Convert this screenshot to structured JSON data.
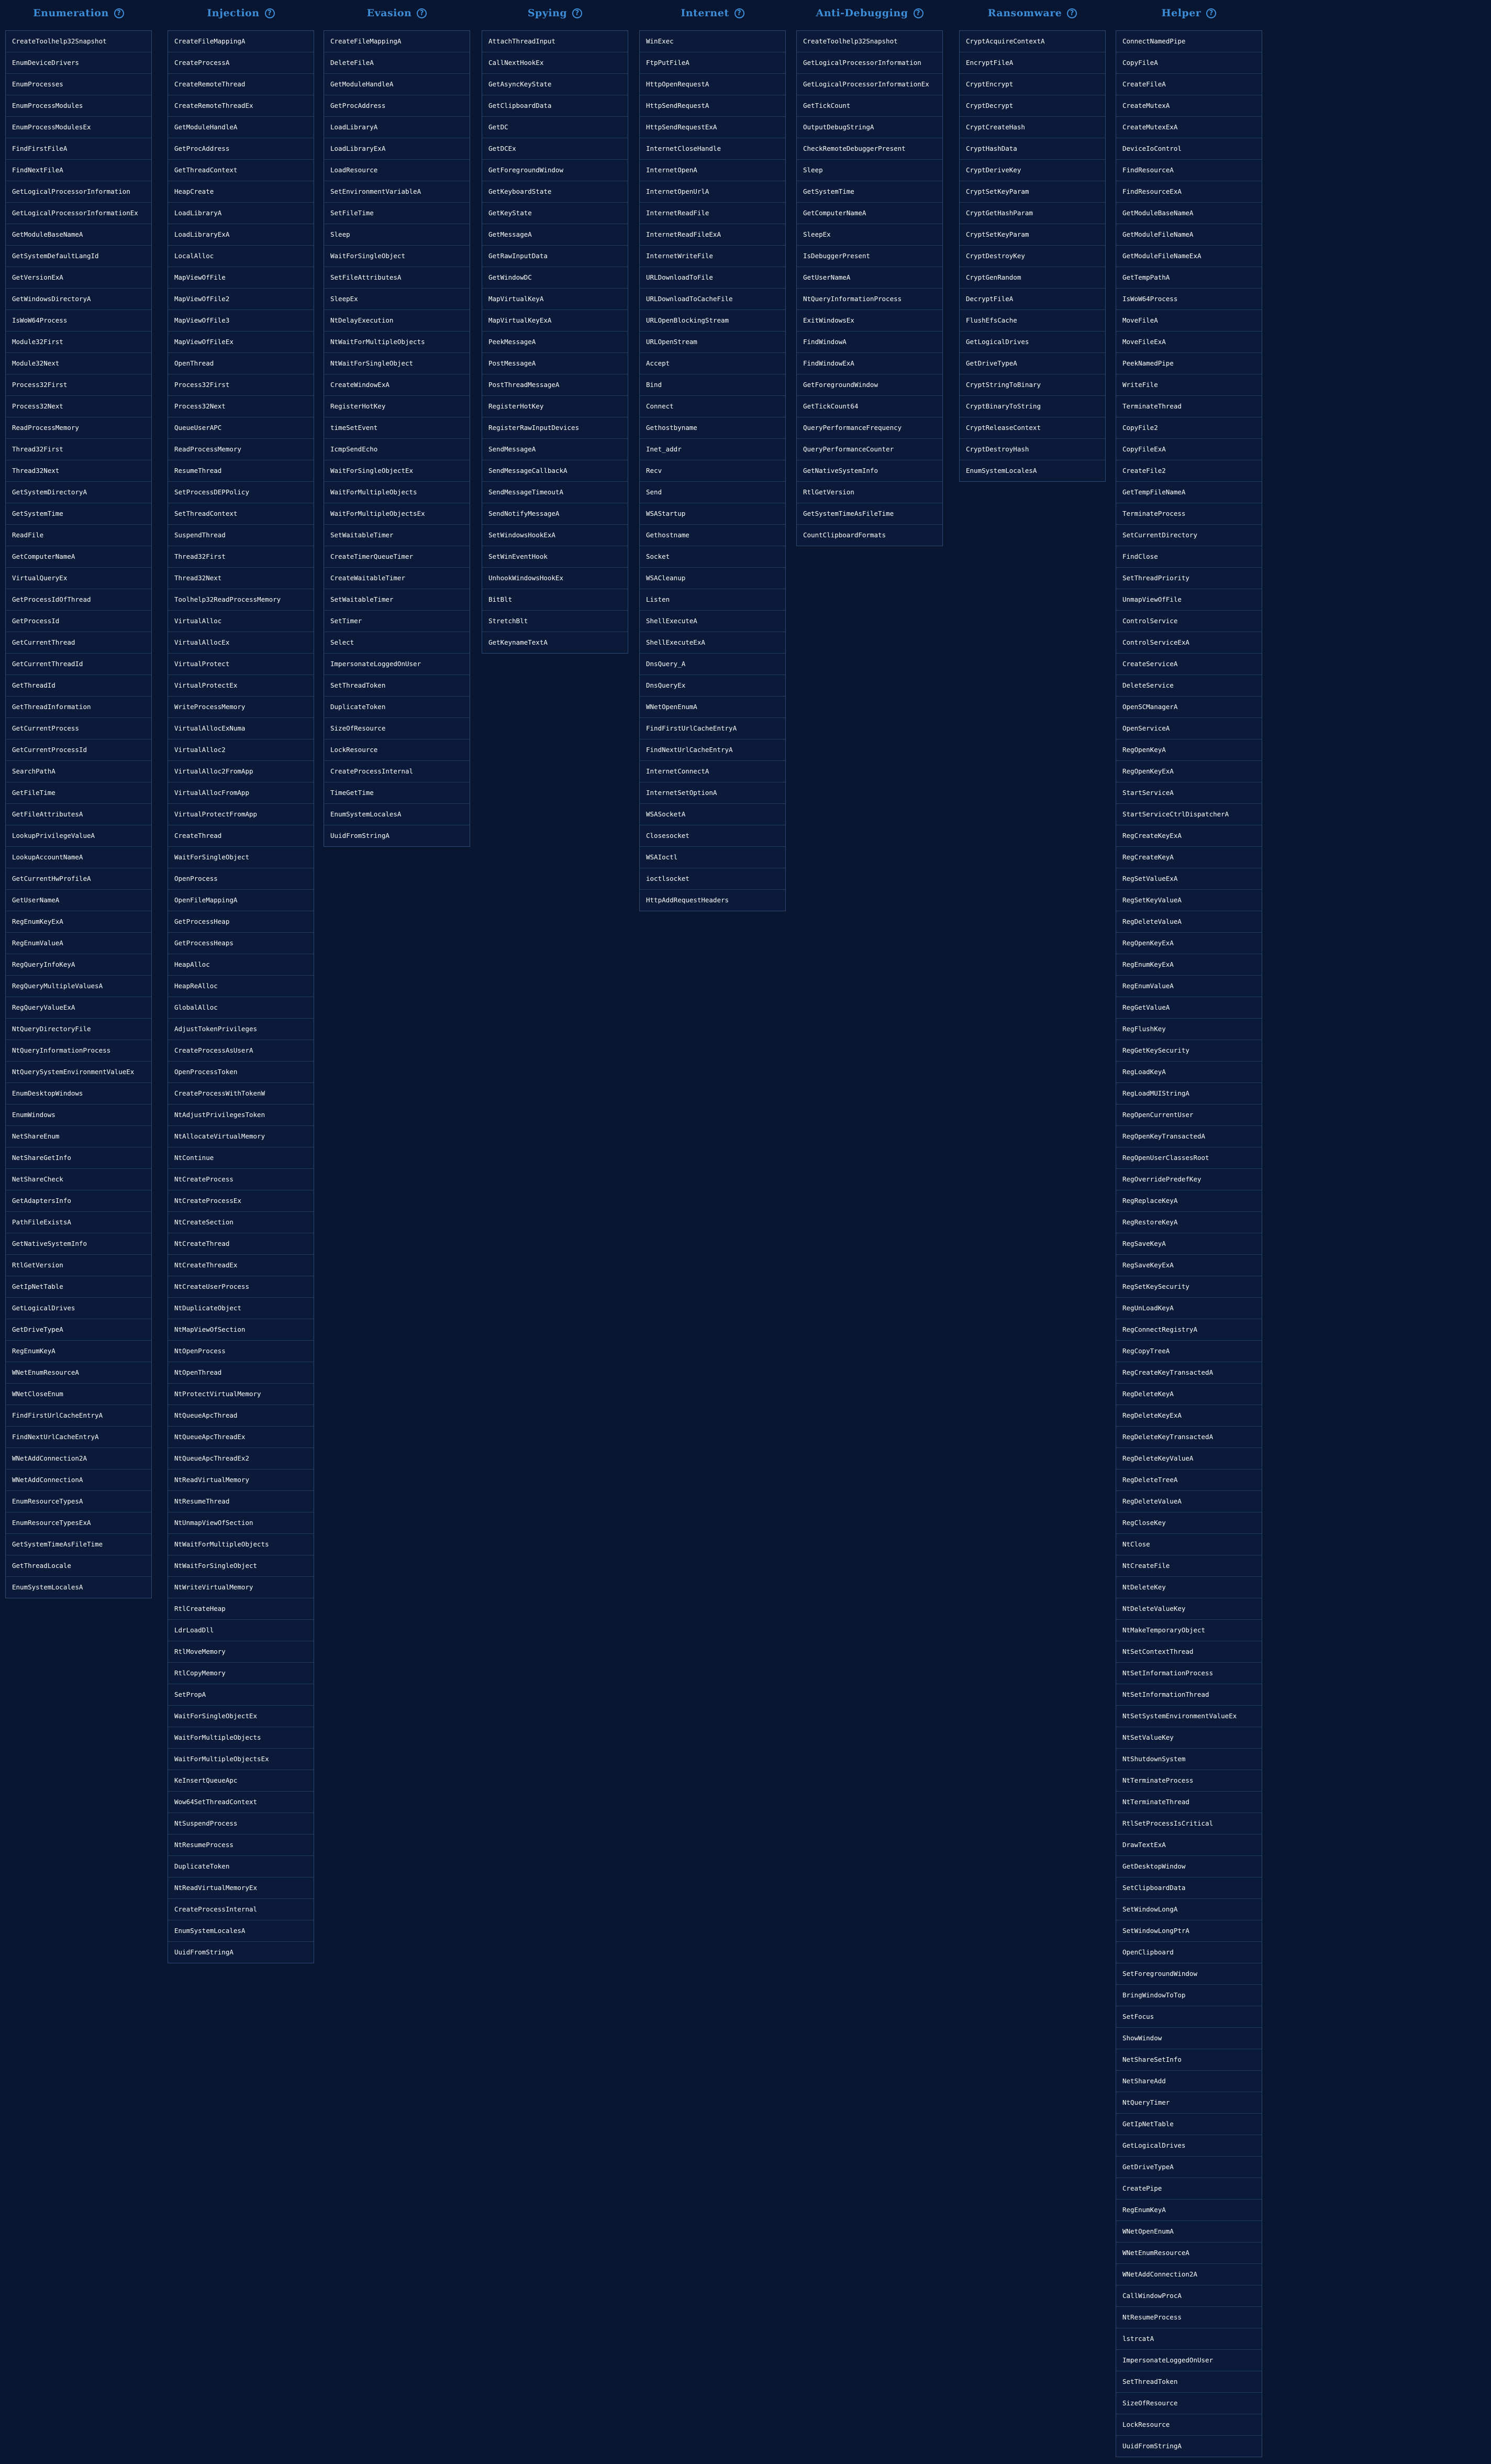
{
  "columns": [
    {
      "title": "Enumeration",
      "items": [
        "CreateToolhelp32Snapshot",
        "EnumDeviceDrivers",
        "EnumProcesses",
        "EnumProcessModules",
        "EnumProcessModulesEx",
        "FindFirstFileA",
        "FindNextFileA",
        "GetLogicalProcessorInformation",
        "GetLogicalProcessorInformationEx",
        "GetModuleBaseNameA",
        "GetSystemDefaultLangId",
        "GetVersionExA",
        "GetWindowsDirectoryA",
        "IsWoW64Process",
        "Module32First",
        "Module32Next",
        "Process32First",
        "Process32Next",
        "ReadProcessMemory",
        "Thread32First",
        "Thread32Next",
        "GetSystemDirectoryA",
        "GetSystemTime",
        "ReadFile",
        "GetComputerNameA",
        "VirtualQueryEx",
        "GetProcessIdOfThread",
        "GetProcessId",
        "GetCurrentThread",
        "GetCurrentThreadId",
        "GetThreadId",
        "GetThreadInformation",
        "GetCurrentProcess",
        "GetCurrentProcessId",
        "SearchPathA",
        "GetFileTime",
        "GetFileAttributesA",
        "LookupPrivilegeValueA",
        "LookupAccountNameA",
        "GetCurrentHwProfileA",
        "GetUserNameA",
        "RegEnumKeyExA",
        "RegEnumValueA",
        "RegQueryInfoKeyA",
        "RegQueryMultipleValuesA",
        "RegQueryValueExA",
        "NtQueryDirectoryFile",
        "NtQueryInformationProcess",
        "NtQuerySystemEnvironmentValueEx",
        "EnumDesktopWindows",
        "EnumWindows",
        "NetShareEnum",
        "NetShareGetInfo",
        "NetShareCheck",
        "GetAdaptersInfo",
        "PathFileExistsA",
        "GetNativeSystemInfo",
        "RtlGetVersion",
        "GetIpNetTable",
        "GetLogicalDrives",
        "GetDriveTypeA",
        "RegEnumKeyA",
        "WNetEnumResourceA",
        "WNetCloseEnum",
        "FindFirstUrlCacheEntryA",
        "FindNextUrlCacheEntryA",
        "WNetAddConnection2A",
        "WNetAddConnectionA",
        "EnumResourceTypesA",
        "EnumResourceTypesExA",
        "GetSystemTimeAsFileTime",
        "GetThreadLocale",
        "EnumSystemLocalesA"
      ]
    },
    {
      "title": "Injection",
      "items": [
        "CreateFileMappingA",
        "CreateProcessA",
        "CreateRemoteThread",
        "CreateRemoteThreadEx",
        "GetModuleHandleA",
        "GetProcAddress",
        "GetThreadContext",
        "HeapCreate",
        "LoadLibraryA",
        "LoadLibraryExA",
        "LocalAlloc",
        "MapViewOfFile",
        "MapViewOfFile2",
        "MapViewOfFile3",
        "MapViewOfFileEx",
        "OpenThread",
        "Process32First",
        "Process32Next",
        "QueueUserAPC",
        "ReadProcessMemory",
        "ResumeThread",
        "SetProcessDEPPolicy",
        "SetThreadContext",
        "SuspendThread",
        "Thread32First",
        "Thread32Next",
        "Toolhelp32ReadProcessMemory",
        "VirtualAlloc",
        "VirtualAllocEx",
        "VirtualProtect",
        "VirtualProtectEx",
        "WriteProcessMemory",
        "VirtualAllocExNuma",
        "VirtualAlloc2",
        "VirtualAlloc2FromApp",
        "VirtualAllocFromApp",
        "VirtualProtectFromApp",
        "CreateThread",
        "WaitForSingleObject",
        "OpenProcess",
        "OpenFileMappingA",
        "GetProcessHeap",
        "GetProcessHeaps",
        "HeapAlloc",
        "HeapReAlloc",
        "GlobalAlloc",
        "AdjustTokenPrivileges",
        "CreateProcessAsUserA",
        "OpenProcessToken",
        "CreateProcessWithTokenW",
        "NtAdjustPrivilegesToken",
        "NtAllocateVirtualMemory",
        "NtContinue",
        "NtCreateProcess",
        "NtCreateProcessEx",
        "NtCreateSection",
        "NtCreateThread",
        "NtCreateThreadEx",
        "NtCreateUserProcess",
        "NtDuplicateObject",
        "NtMapViewOfSection",
        "NtOpenProcess",
        "NtOpenThread",
        "NtProtectVirtualMemory",
        "NtQueueApcThread",
        "NtQueueApcThreadEx",
        "NtQueueApcThreadEx2",
        "NtReadVirtualMemory",
        "NtResumeThread",
        "NtUnmapViewOfSection",
        "NtWaitForMultipleObjects",
        "NtWaitForSingleObject",
        "NtWriteVirtualMemory",
        "RtlCreateHeap",
        "LdrLoadDll",
        "RtlMoveMemory",
        "RtlCopyMemory",
        "SetPropA",
        "WaitForSingleObjectEx",
        "WaitForMultipleObjects",
        "WaitForMultipleObjectsEx",
        "KeInsertQueueApc",
        "Wow64SetThreadContext",
        "NtSuspendProcess",
        "NtResumeProcess",
        "DuplicateToken",
        "NtReadVirtualMemoryEx",
        "CreateProcessInternal",
        "EnumSystemLocalesA",
        "UuidFromStringA"
      ]
    },
    {
      "title": "Evasion",
      "items": [
        "CreateFileMappingA",
        "DeleteFileA",
        "GetModuleHandleA",
        "GetProcAddress",
        "LoadLibraryA",
        "LoadLibraryExA",
        "LoadResource",
        "SetEnvironmentVariableA",
        "SetFileTime",
        "Sleep",
        "WaitForSingleObject",
        "SetFileAttributesA",
        "SleepEx",
        "NtDelayExecution",
        "NtWaitForMultipleObjects",
        "NtWaitForSingleObject",
        "CreateWindowExA",
        "RegisterHotKey",
        "timeSetEvent",
        "IcmpSendEcho",
        "WaitForSingleObjectEx",
        "WaitForMultipleObjects",
        "WaitForMultipleObjectsEx",
        "SetWaitableTimer",
        "CreateTimerQueueTimer",
        "CreateWaitableTimer",
        "SetWaitableTimer",
        "SetTimer",
        "Select",
        "ImpersonateLoggedOnUser",
        "SetThreadToken",
        "DuplicateToken",
        "SizeOfResource",
        "LockResource",
        "CreateProcessInternal",
        "TimeGetTime",
        "EnumSystemLocalesA",
        "UuidFromStringA"
      ]
    },
    {
      "title": "Spying",
      "items": [
        "AttachThreadInput",
        "CallNextHookEx",
        "GetAsyncKeyState",
        "GetClipboardData",
        "GetDC",
        "GetDCEx",
        "GetForegroundWindow",
        "GetKeyboardState",
        "GetKeyState",
        "GetMessageA",
        "GetRawInputData",
        "GetWindowDC",
        "MapVirtualKeyA",
        "MapVirtualKeyExA",
        "PeekMessageA",
        "PostMessageA",
        "PostThreadMessageA",
        "RegisterHotKey",
        "RegisterRawInputDevices",
        "SendMessageA",
        "SendMessageCallbackA",
        "SendMessageTimeoutA",
        "SendNotifyMessageA",
        "SetWindowsHookExA",
        "SetWinEventHook",
        "UnhookWindowsHookEx",
        "BitBlt",
        "StretchBlt",
        "GetKeynameTextA"
      ]
    },
    {
      "title": "Internet",
      "items": [
        "WinExec",
        "FtpPutFileA",
        "HttpOpenRequestA",
        "HttpSendRequestA",
        "HttpSendRequestExA",
        "InternetCloseHandle",
        "InternetOpenA",
        "InternetOpenUrlA",
        "InternetReadFile",
        "InternetReadFileExA",
        "InternetWriteFile",
        "URLDownloadToFile",
        "URLDownloadToCacheFile",
        "URLOpenBlockingStream",
        "URLOpenStream",
        "Accept",
        "Bind",
        "Connect",
        "Gethostbyname",
        "Inet_addr",
        "Recv",
        "Send",
        "WSAStartup",
        "Gethostname",
        "Socket",
        "WSACleanup",
        "Listen",
        "ShellExecuteA",
        "ShellExecuteExA",
        "DnsQuery_A",
        "DnsQueryEx",
        "WNetOpenEnumA",
        "FindFirstUrlCacheEntryA",
        "FindNextUrlCacheEntryA",
        "InternetConnectA",
        "InternetSetOptionA",
        "WSASocketA",
        "Closesocket",
        "WSAIoctl",
        "ioctlsocket",
        "HttpAddRequestHeaders"
      ]
    },
    {
      "title": "Anti-Debugging",
      "items": [
        "CreateToolhelp32Snapshot",
        "GetLogicalProcessorInformation",
        "GetLogicalProcessorInformationEx",
        "GetTickCount",
        "OutputDebugStringA",
        "CheckRemoteDebuggerPresent",
        "Sleep",
        "GetSystemTime",
        "GetComputerNameA",
        "SleepEx",
        "IsDebuggerPresent",
        "GetUserNameA",
        "NtQueryInformationProcess",
        "ExitWindowsEx",
        "FindWindowA",
        "FindWindowExA",
        "GetForegroundWindow",
        "GetTickCount64",
        "QueryPerformanceFrequency",
        "QueryPerformanceCounter",
        "GetNativeSystemInfo",
        "RtlGetVersion",
        "GetSystemTimeAsFileTime",
        "CountClipboardFormats"
      ]
    },
    {
      "title": "Ransomware",
      "items": [
        "CryptAcquireContextA",
        "EncryptFileA",
        "CryptEncrypt",
        "CryptDecrypt",
        "CryptCreateHash",
        "CryptHashData",
        "CryptDeriveKey",
        "CryptSetKeyParam",
        "CryptGetHashParam",
        "CryptSetKeyParam",
        "CryptDestroyKey",
        "CryptGenRandom",
        "DecryptFileA",
        "FlushEfsCache",
        "GetLogicalDrives",
        "GetDriveTypeA",
        "CryptStringToBinary",
        "CryptBinaryToString",
        "CryptReleaseContext",
        "CryptDestroyHash",
        "EnumSystemLocalesA"
      ]
    },
    {
      "title": "Helper",
      "items": [
        "ConnectNamedPipe",
        "CopyFileA",
        "CreateFileA",
        "CreateMutexA",
        "CreateMutexExA",
        "DeviceIoControl",
        "FindResourceA",
        "FindResourceExA",
        "GetModuleBaseNameA",
        "GetModuleFileNameA",
        "GetModuleFileNameExA",
        "GetTempPathA",
        "IsWoW64Process",
        "MoveFileA",
        "MoveFileExA",
        "PeekNamedPipe",
        "WriteFile",
        "TerminateThread",
        "CopyFile2",
        "CopyFileExA",
        "CreateFile2",
        "GetTempFileNameA",
        "TerminateProcess",
        "SetCurrentDirectory",
        "FindClose",
        "SetThreadPriority",
        "UnmapViewOfFile",
        "ControlService",
        "ControlServiceExA",
        "CreateServiceA",
        "DeleteService",
        "OpenSCManagerA",
        "OpenServiceA",
        "RegOpenKeyA",
        "RegOpenKeyExA",
        "StartServiceA",
        "StartServiceCtrlDispatcherA",
        "RegCreateKeyExA",
        "RegCreateKeyA",
        "RegSetValueExA",
        "RegSetKeyValueA",
        "RegDeleteValueA",
        "RegOpenKeyExA",
        "RegEnumKeyExA",
        "RegEnumValueA",
        "RegGetValueA",
        "RegFlushKey",
        "RegGetKeySecurity",
        "RegLoadKeyA",
        "RegLoadMUIStringA",
        "RegOpenCurrentUser",
        "RegOpenKeyTransactedA",
        "RegOpenUserClassesRoot",
        "RegOverridePredefKey",
        "RegReplaceKeyA",
        "RegRestoreKeyA",
        "RegSaveKeyA",
        "RegSaveKeyExA",
        "RegSetKeySecurity",
        "RegUnLoadKeyA",
        "RegConnectRegistryA",
        "RegCopyTreeA",
        "RegCreateKeyTransactedA",
        "RegDeleteKeyA",
        "RegDeleteKeyExA",
        "RegDeleteKeyTransactedA",
        "RegDeleteKeyValueA",
        "RegDeleteTreeA",
        "RegDeleteValueA",
        "RegCloseKey",
        "NtClose",
        "NtCreateFile",
        "NtDeleteKey",
        "NtDeleteValueKey",
        "NtMakeTemporaryObject",
        "NtSetContextThread",
        "NtSetInformationProcess",
        "NtSetInformationThread",
        "NtSetSystemEnvironmentValueEx",
        "NtSetValueKey",
        "NtShutdownSystem",
        "NtTerminateProcess",
        "NtTerminateThread",
        "RtlSetProcessIsCritical",
        "DrawTextExA",
        "GetDesktopWindow",
        "SetClipboardData",
        "SetWindowLongA",
        "SetWindowLongPtrA",
        "OpenClipboard",
        "SetForegroundWindow",
        "BringWindowToTop",
        "SetFocus",
        "ShowWindow",
        "NetShareSetInfo",
        "NetShareAdd",
        "NtQueryTimer",
        "GetIpNetTable",
        "GetLogicalDrives",
        "GetDriveTypeA",
        "CreatePipe",
        "RegEnumKeyA",
        "WNetOpenEnumA",
        "WNetEnumResourceA",
        "WNetAddConnection2A",
        "CallWindowProcA",
        "NtResumeProcess",
        "lstrcatA",
        "ImpersonateLoggedOnUser",
        "SetThreadToken",
        "SizeOfResource",
        "LockResource",
        "UuidFromStringA"
      ]
    }
  ],
  "help_glyph": "?",
  "icons": {
    "help": "help-circle-icon"
  }
}
